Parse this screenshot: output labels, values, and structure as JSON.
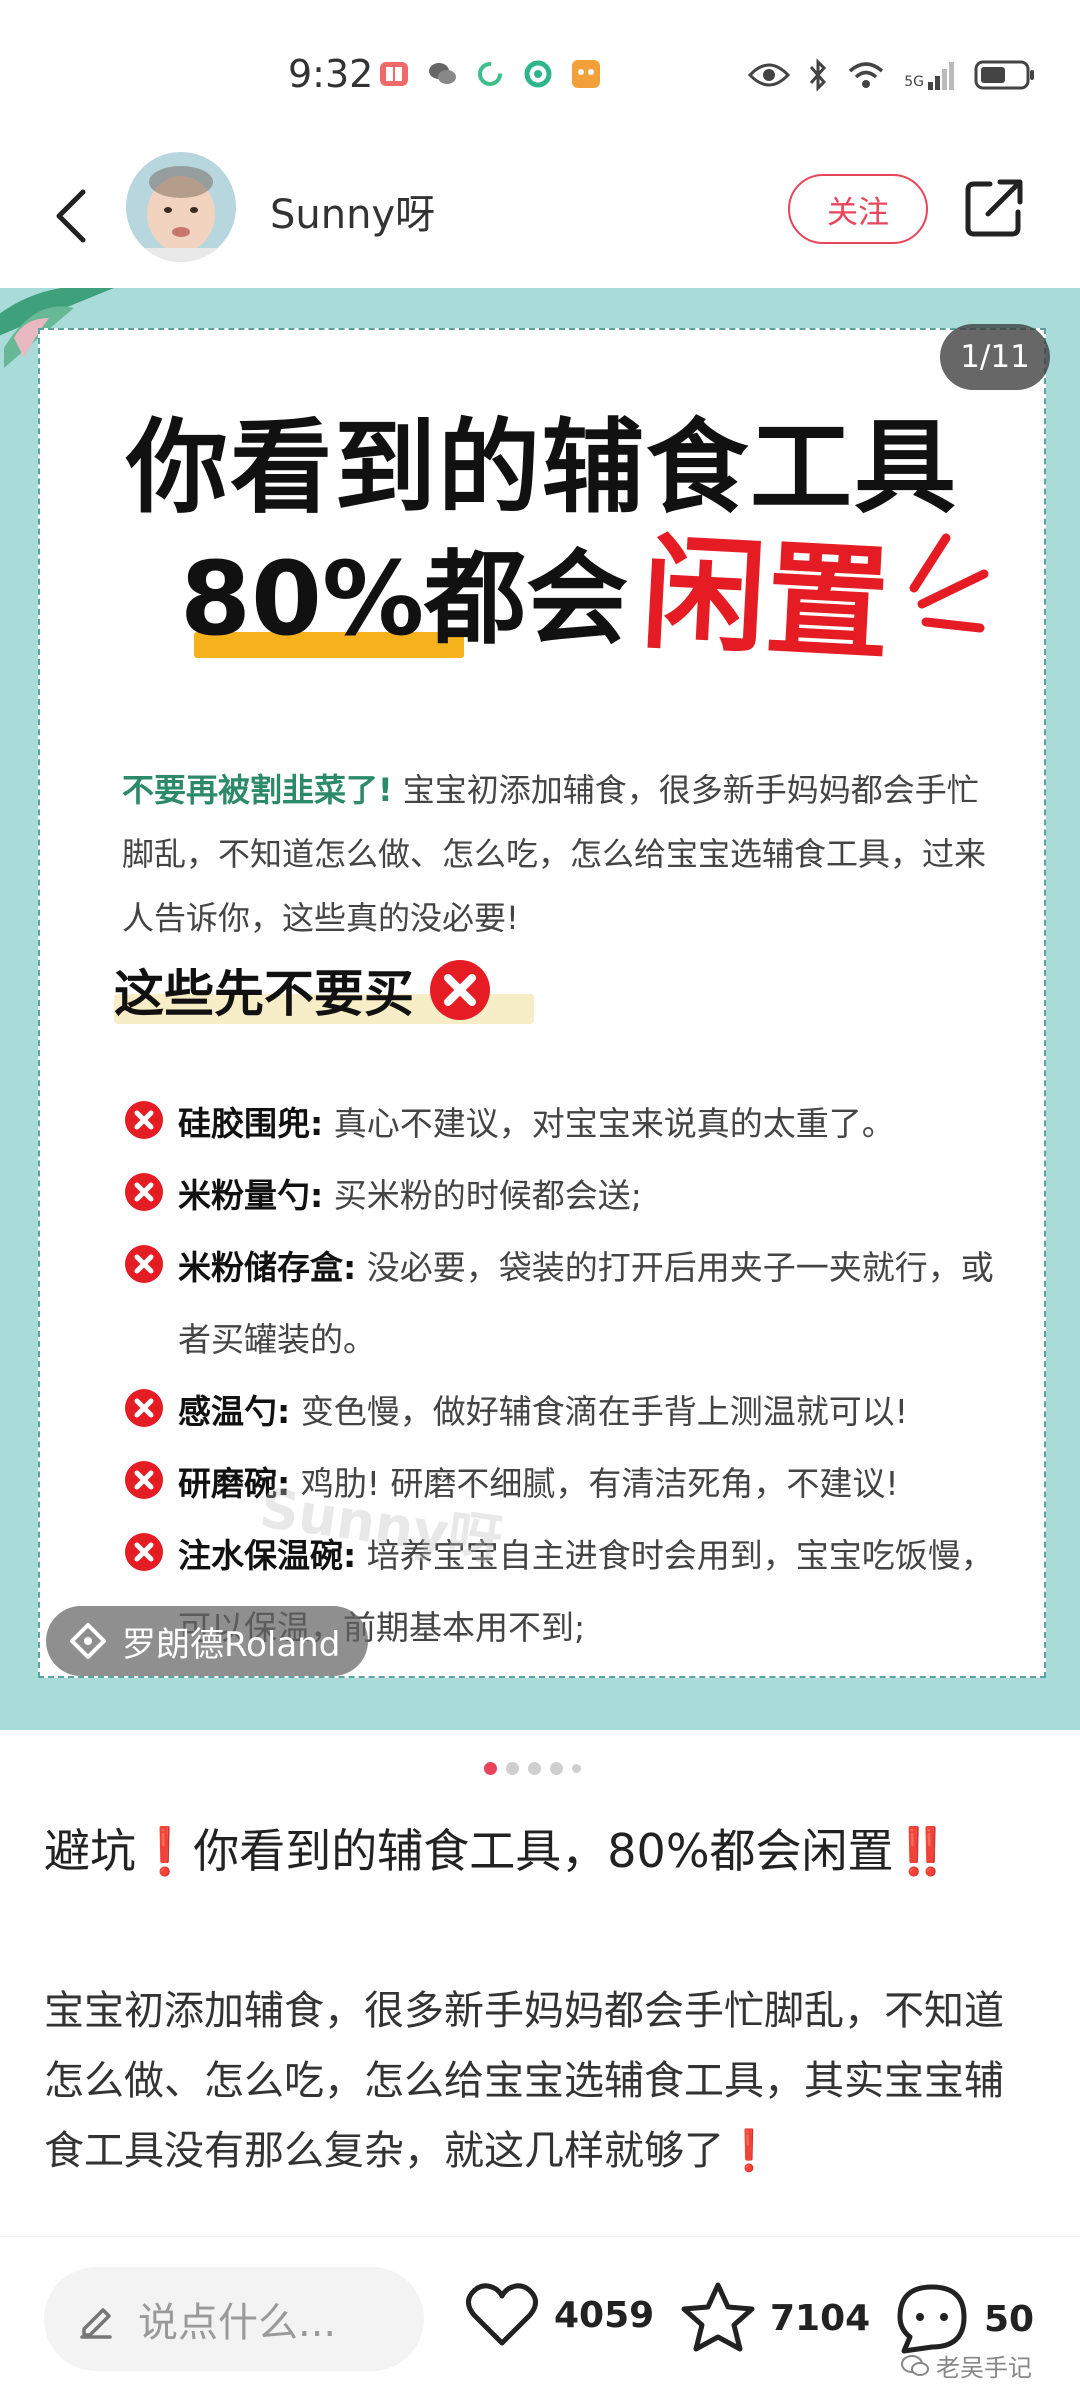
{
  "status_bar": {
    "time": "9:32",
    "network": "5G"
  },
  "header": {
    "author_name": "Sunny呀",
    "follow_label": "关注"
  },
  "image": {
    "page_counter": "1/11",
    "title_line1": "你看到的辅食工具",
    "title_line2_plain": "80%都会",
    "title_line2_red": "闲置",
    "intro_lead": "不要再被割韭菜了!",
    "intro_rest": " 宝宝初添加辅食，很多新手妈妈都会手忙脚乱，不知道怎么做、怎么吃，怎么给宝宝选辅食工具，过来人告诉你，这些真的没必要!",
    "section_heading": "这些先不要买",
    "items": [
      {
        "label": "硅胶围兜:",
        "text": " 真心不建议，对宝宝来说真的太重了。"
      },
      {
        "label": "米粉量勺:",
        "text": " 买米粉的时候都会送;"
      },
      {
        "label": "米粉储存盒:",
        "text": " 没必要，袋装的打开后用夹子一夹就行，或者买罐装的。"
      },
      {
        "label": "感温勺:",
        "text": " 变色慢，做好辅食滴在手背上测温就可以!"
      },
      {
        "label": "研磨碗:",
        "text": " 鸡肋! 研磨不细腻，有清洁死角，不建议!"
      },
      {
        "label": "注水保温碗:",
        "text": " 培养宝宝自主进食时会用到，宝宝吃饭慢，可以保温，前期基本用不到;"
      }
    ],
    "watermark": "Sunny呀",
    "author_tag": "罗朗德Roland"
  },
  "post": {
    "title_a": "避坑",
    "title_mark1": "❗",
    "title_b": "你看到的辅食工具，80%都会闲置",
    "title_mark2": "‼️",
    "body_main": "宝宝初添加辅食，很多新手妈妈都会手忙脚乱，不知道怎么做、怎么吃，怎么给宝宝选辅食工具，其实宝宝辅食工具没有那么复杂，就这几样就够了",
    "body_mark": "❗"
  },
  "bottom_bar": {
    "comment_placeholder": "说点什么...",
    "likes": "4059",
    "collects": "7104",
    "comments": "50",
    "source_mark": "老吴手记"
  },
  "colors": {
    "accent": "#e8455a",
    "image_bg": "#a9dcd9",
    "highlight": "#f5b21d",
    "title_red": "#e51c24"
  }
}
